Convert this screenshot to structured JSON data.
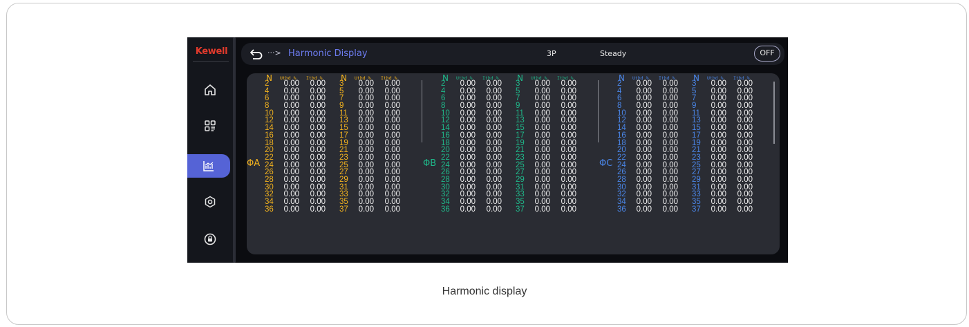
{
  "app": {
    "logo": "Kewell",
    "title": "Harmonic Display",
    "crumb_arrow": "···>",
    "mode": "3P",
    "state": "Steady",
    "toggle": "OFF"
  },
  "sidebar": {
    "items": [
      {
        "icon": "home-icon"
      },
      {
        "icon": "apps-grid-icon"
      },
      {
        "icon": "chart-icon",
        "active": true
      },
      {
        "icon": "settings-hex-icon"
      },
      {
        "icon": "lock-icon"
      }
    ]
  },
  "headers": {
    "n": "N",
    "uthd": "Uthd %",
    "ithd": "Ithd %"
  },
  "phases": [
    {
      "label": "ΦA",
      "color": "#f2b21e"
    },
    {
      "label": "ΦB",
      "color": "#1fb88a"
    },
    {
      "label": "ΦC",
      "color": "#4a86e8"
    }
  ],
  "table": {
    "even_orders": [
      "2",
      "4",
      "6",
      "8",
      "10",
      "12",
      "14",
      "16",
      "18",
      "20",
      "22",
      "24",
      "26",
      "28",
      "30",
      "32",
      "34",
      "36"
    ],
    "odd_orders": [
      "3",
      "5",
      "7",
      "9",
      "11",
      "13",
      "15",
      "17",
      "19",
      "21",
      "23",
      "25",
      "27",
      "29",
      "31",
      "33",
      "35",
      "37"
    ],
    "value": "0.00"
  },
  "caption": "Harmonic display"
}
